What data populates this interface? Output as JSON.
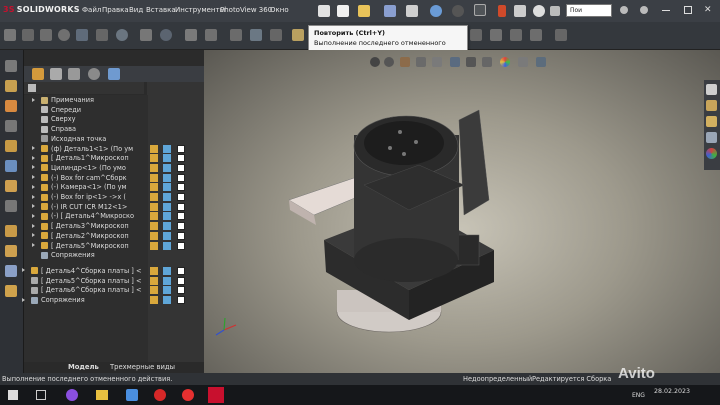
{
  "app": {
    "brand_ds": "3S",
    "brand_name": "SOLIDWORKS"
  },
  "menu": [
    "Файл",
    "Правка",
    "Вид",
    "Вставка",
    "Инструменты",
    "PhotoView 360",
    "Окно"
  ],
  "search": {
    "placeholder": "Пои"
  },
  "tooltip": {
    "title": "Повторить   (Ctrl+Y)",
    "text": "Выполнение последнего отмененного действия."
  },
  "tree": [
    {
      "label": "Примечания",
      "indent": 1,
      "arrow": true
    },
    {
      "label": "Спереди",
      "indent": 1,
      "arrow": false
    },
    {
      "label": "Сверху",
      "indent": 1,
      "arrow": false
    },
    {
      "label": "Справа",
      "indent": 1,
      "arrow": false
    },
    {
      "label": "Исходная точка",
      "indent": 1,
      "arrow": false
    },
    {
      "label": "(ф) Деталь1<1> (По ум",
      "indent": 1,
      "arrow": true
    },
    {
      "label": "[ Деталь1^Микроскоп",
      "indent": 1,
      "arrow": true
    },
    {
      "label": "Цилиндр<1> (По умо",
      "indent": 1,
      "arrow": true
    },
    {
      "label": "(-) Box for cam^Сборк",
      "indent": 1,
      "arrow": true
    },
    {
      "label": "(-) Камера<1> (По ум",
      "indent": 1,
      "arrow": true
    },
    {
      "label": "(-) Box for ip<1> ->x (",
      "indent": 1,
      "arrow": true
    },
    {
      "label": "(-) IR CUT ICR M12<1>",
      "indent": 1,
      "arrow": true
    },
    {
      "label": "(-) [ Деталь4^Микроско",
      "indent": 1,
      "arrow": true
    },
    {
      "label": "[ Деталь3^Микроскоп",
      "indent": 1,
      "arrow": true
    },
    {
      "label": "[ Деталь2^Микроскоп",
      "indent": 1,
      "arrow": true
    },
    {
      "label": "[ Деталь5^Микроскоп",
      "indent": 1,
      "arrow": true
    },
    {
      "label": "Сопряжения",
      "indent": 1,
      "arrow": false
    },
    {
      "label": "[ Деталь4^Сборка платы ] <",
      "indent": 0,
      "arrow": true
    },
    {
      "label": "[ Деталь5^Сборка платы ] <",
      "indent": 0,
      "arrow": false
    },
    {
      "label": "[ Деталь6^Сборка платы ] <",
      "indent": 0,
      "arrow": false
    },
    {
      "label": "Сопряжения",
      "indent": 0,
      "arrow": true
    }
  ],
  "bottom_tabs": [
    "Модель",
    "Трехмерные виды"
  ],
  "status": {
    "left": "Выполнение последнего отмененного действия.",
    "mid1": "Недоопределенный",
    "mid2": "Редактируется Сборка"
  },
  "taskbar": {
    "lang": "ENG",
    "date": "28.02.2023"
  },
  "watermark": "Avito",
  "colors": {
    "accent": "#3d8ede",
    "bg_viewport": "#a09c8f",
    "tree_bg": "#2e2e2e"
  }
}
